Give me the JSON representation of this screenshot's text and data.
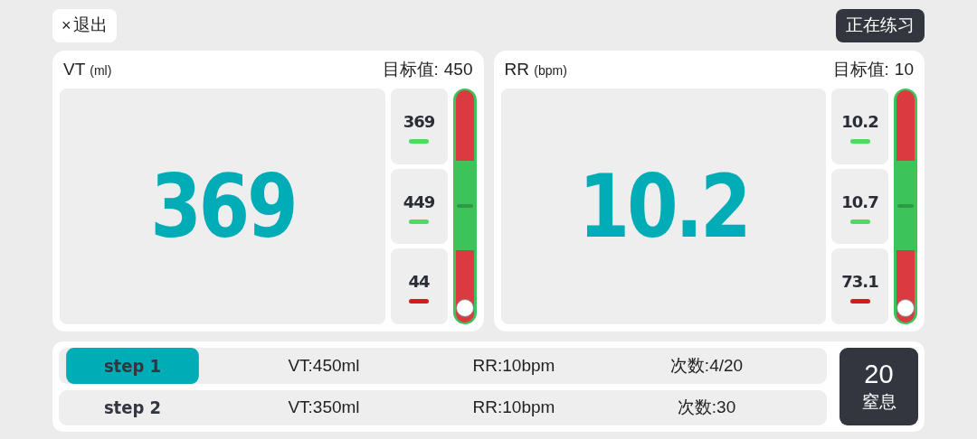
{
  "exit_button": {
    "icon": "×",
    "label": "退出"
  },
  "status_button": "正在练习",
  "panels": [
    {
      "title": "VT",
      "unit": "(ml)",
      "target_label": "目标值:",
      "target_value": "450",
      "value": "369",
      "history": [
        {
          "value": "369",
          "color": "#4cd964"
        },
        {
          "value": "449",
          "color": "#4cd964"
        },
        {
          "value": "44",
          "color": "#d01c1c"
        }
      ],
      "gauge": {
        "level": 0.03
      }
    },
    {
      "title": "RR",
      "unit": "(bpm)",
      "target_label": "目标值:",
      "target_value": "10",
      "value": "10.2",
      "history": [
        {
          "value": "10.2",
          "color": "#4cd964"
        },
        {
          "value": "10.7",
          "color": "#4cd964"
        },
        {
          "value": "73.1",
          "color": "#d01c1c"
        }
      ],
      "gauge": {
        "level": 0.03
      }
    }
  ],
  "steps": [
    {
      "label": "step 1",
      "selected": true,
      "vt": "VT:450ml",
      "rr": "RR:10bpm",
      "count": "次数:4/20"
    },
    {
      "label": "step 2",
      "selected": false,
      "vt": "VT:350ml",
      "rr": "RR:10bpm",
      "count": "次数:30"
    }
  ],
  "apnea": {
    "value": "20",
    "label": "窒息"
  }
}
